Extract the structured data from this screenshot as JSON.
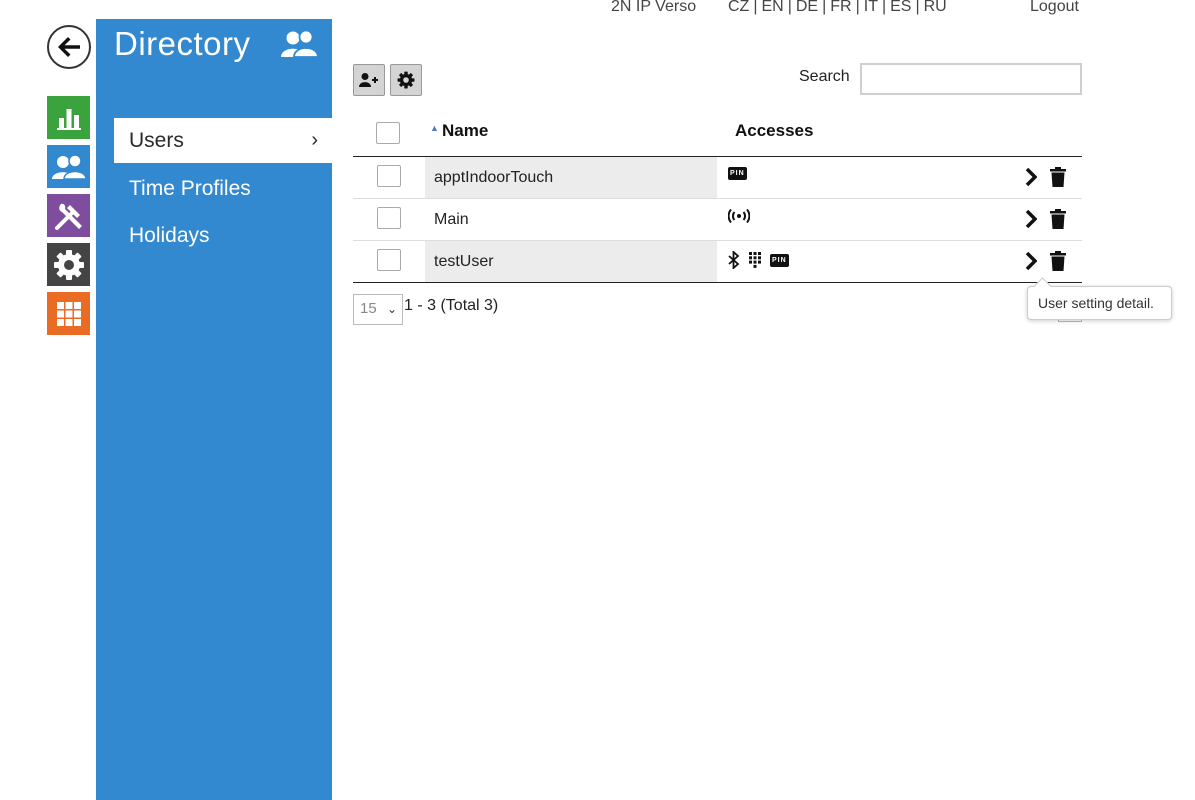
{
  "header": {
    "device_name": "2N IP Verso",
    "languages": [
      "CZ",
      "EN",
      "DE",
      "FR",
      "IT",
      "ES",
      "RU"
    ],
    "logout_label": "Logout"
  },
  "rail": {
    "items": [
      {
        "name": "status",
        "icon": "bar-chart-icon",
        "color": "#3aa33e"
      },
      {
        "name": "directory",
        "icon": "users-icon",
        "color": "#3289cf"
      },
      {
        "name": "hardware",
        "icon": "tools-icon",
        "color": "#7f4d9e"
      },
      {
        "name": "services",
        "icon": "gear-icon",
        "color": "#444444"
      },
      {
        "name": "system",
        "icon": "grid-icon",
        "color": "#ea6b23"
      }
    ]
  },
  "sidebar": {
    "title": "Directory",
    "items": [
      {
        "label": "Users",
        "active": true
      },
      {
        "label": "Time Profiles",
        "active": false
      },
      {
        "label": "Holidays",
        "active": false
      }
    ]
  },
  "toolbar": {
    "search_label": "Search",
    "search_value": ""
  },
  "table": {
    "columns": [
      "Name",
      "Accesses"
    ],
    "rows": [
      {
        "name": "apptIndoorTouch",
        "accesses": [
          "pin"
        ]
      },
      {
        "name": "Main",
        "accesses": [
          "rfid"
        ]
      },
      {
        "name": "testUser",
        "accesses": [
          "bluetooth",
          "keypad",
          "pin"
        ]
      }
    ],
    "pin_label": "PIN"
  },
  "pager": {
    "page_size": "15",
    "info": "1 - 3 (Total 3)"
  },
  "tooltip": {
    "text": "User setting detail."
  }
}
